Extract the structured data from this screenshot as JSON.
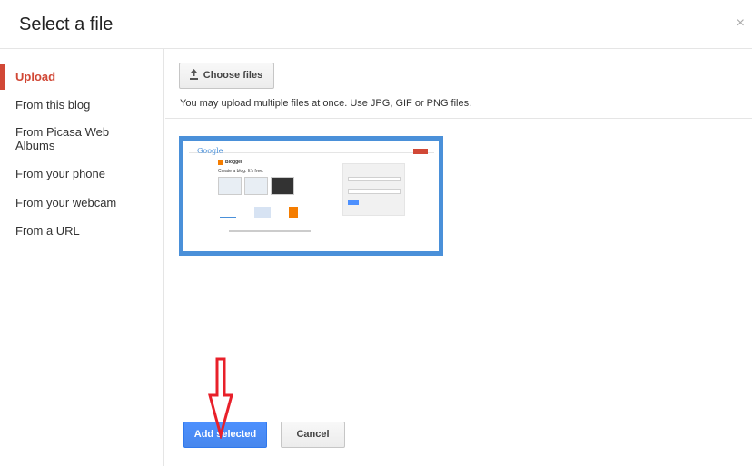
{
  "dialog": {
    "title": "Select a file",
    "close_label": "×"
  },
  "sidebar": {
    "items": [
      {
        "label": "Upload",
        "active": true
      },
      {
        "label": "From this blog"
      },
      {
        "label": "From Picasa Web Albums"
      },
      {
        "label": "From your phone"
      },
      {
        "label": "From your webcam"
      },
      {
        "label": "From a URL"
      }
    ]
  },
  "upload": {
    "choose_label": "Choose files",
    "hint": "You may upload multiple files at once. Use JPG, GIF or PNG files."
  },
  "thumbnail": {
    "logo_text": "Google",
    "blog_text": "Blogger",
    "tagline": "Create a blog. It's free."
  },
  "footer": {
    "add_label": "Add selected",
    "cancel_label": "Cancel"
  },
  "colors": {
    "accent_red": "#d14836",
    "primary_blue": "#4d90fe",
    "thumb_border": "#4a90d9",
    "annotation_arrow": "#e8202a"
  }
}
